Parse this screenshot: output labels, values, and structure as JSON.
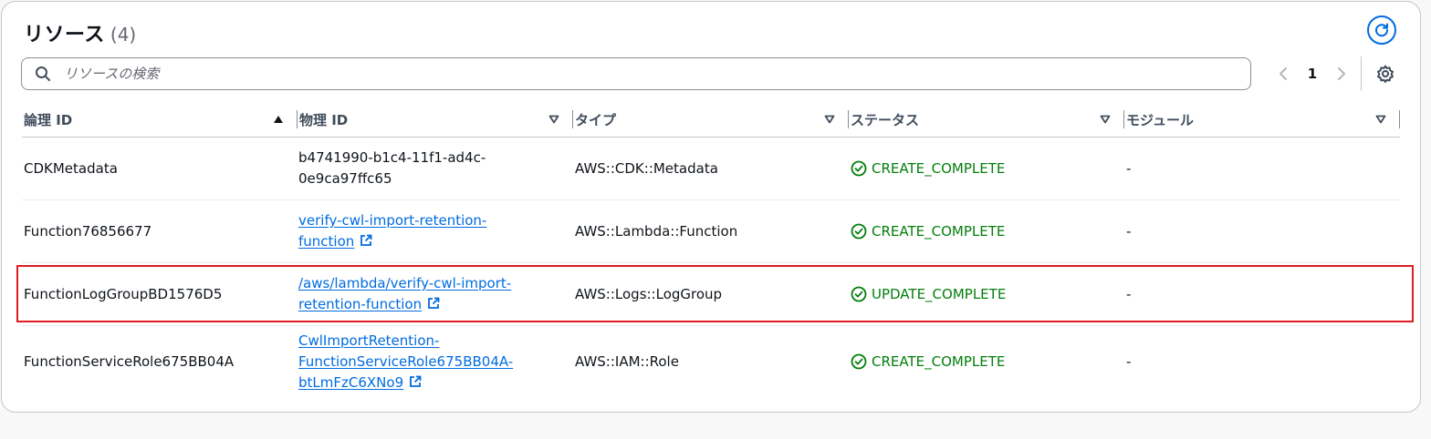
{
  "header": {
    "title": "リソース",
    "count": "(4)"
  },
  "search": {
    "placeholder": "リソースの検索",
    "value": ""
  },
  "pagination": {
    "current_page": "1"
  },
  "columns": [
    {
      "label": "論理 ID",
      "sort": "ascending"
    },
    {
      "label": "物理 ID",
      "sort": "none"
    },
    {
      "label": "タイプ",
      "sort": "none"
    },
    {
      "label": "ステータス",
      "sort": "none"
    },
    {
      "label": "モジュール",
      "sort": "none"
    }
  ],
  "rows": [
    {
      "logical_id": "CDKMetadata",
      "physical_id_lines": [
        "b4741990-b1c4-11f1-ad4c-",
        "0e9ca97ffc65"
      ],
      "physical_is_link": false,
      "type": "AWS::CDK::Metadata",
      "status": "CREATE_COMPLETE",
      "module": "-"
    },
    {
      "logical_id": "Function76856677",
      "physical_id_lines": [
        "verify-cwl-import-retention-",
        "function"
      ],
      "physical_is_link": true,
      "type": "AWS::Lambda::Function",
      "status": "CREATE_COMPLETE",
      "module": "-"
    },
    {
      "logical_id": "FunctionLogGroupBD1576D5",
      "physical_id_lines": [
        "/aws/lambda/verify-cwl-import-",
        "retention-function"
      ],
      "physical_is_link": true,
      "type": "AWS::Logs::LogGroup",
      "status": "UPDATE_COMPLETE",
      "module": "-",
      "highlighted": true
    },
    {
      "logical_id": "FunctionServiceRole675BB04A",
      "physical_id_lines": [
        "CwlImportRetention-",
        "FunctionServiceRole675BB04A-",
        "btLmFzC6XNo9"
      ],
      "physical_is_link": true,
      "type": "AWS::IAM::Role",
      "status": "CREATE_COMPLETE",
      "module": "-"
    }
  ],
  "colors": {
    "link": "#006ce0",
    "success": "#037f0c",
    "highlight_border": "#e01b24",
    "header_text": "#414d5c"
  },
  "icons": {
    "refresh": "refresh-icon",
    "search": "search-icon",
    "prev": "chevron-left-icon",
    "next": "chevron-right-icon",
    "settings": "gear-icon",
    "sort_asc": "caret-up-icon",
    "sort_none": "caret-down-icon",
    "status_ok": "check-circle-icon",
    "external": "external-link-icon"
  }
}
